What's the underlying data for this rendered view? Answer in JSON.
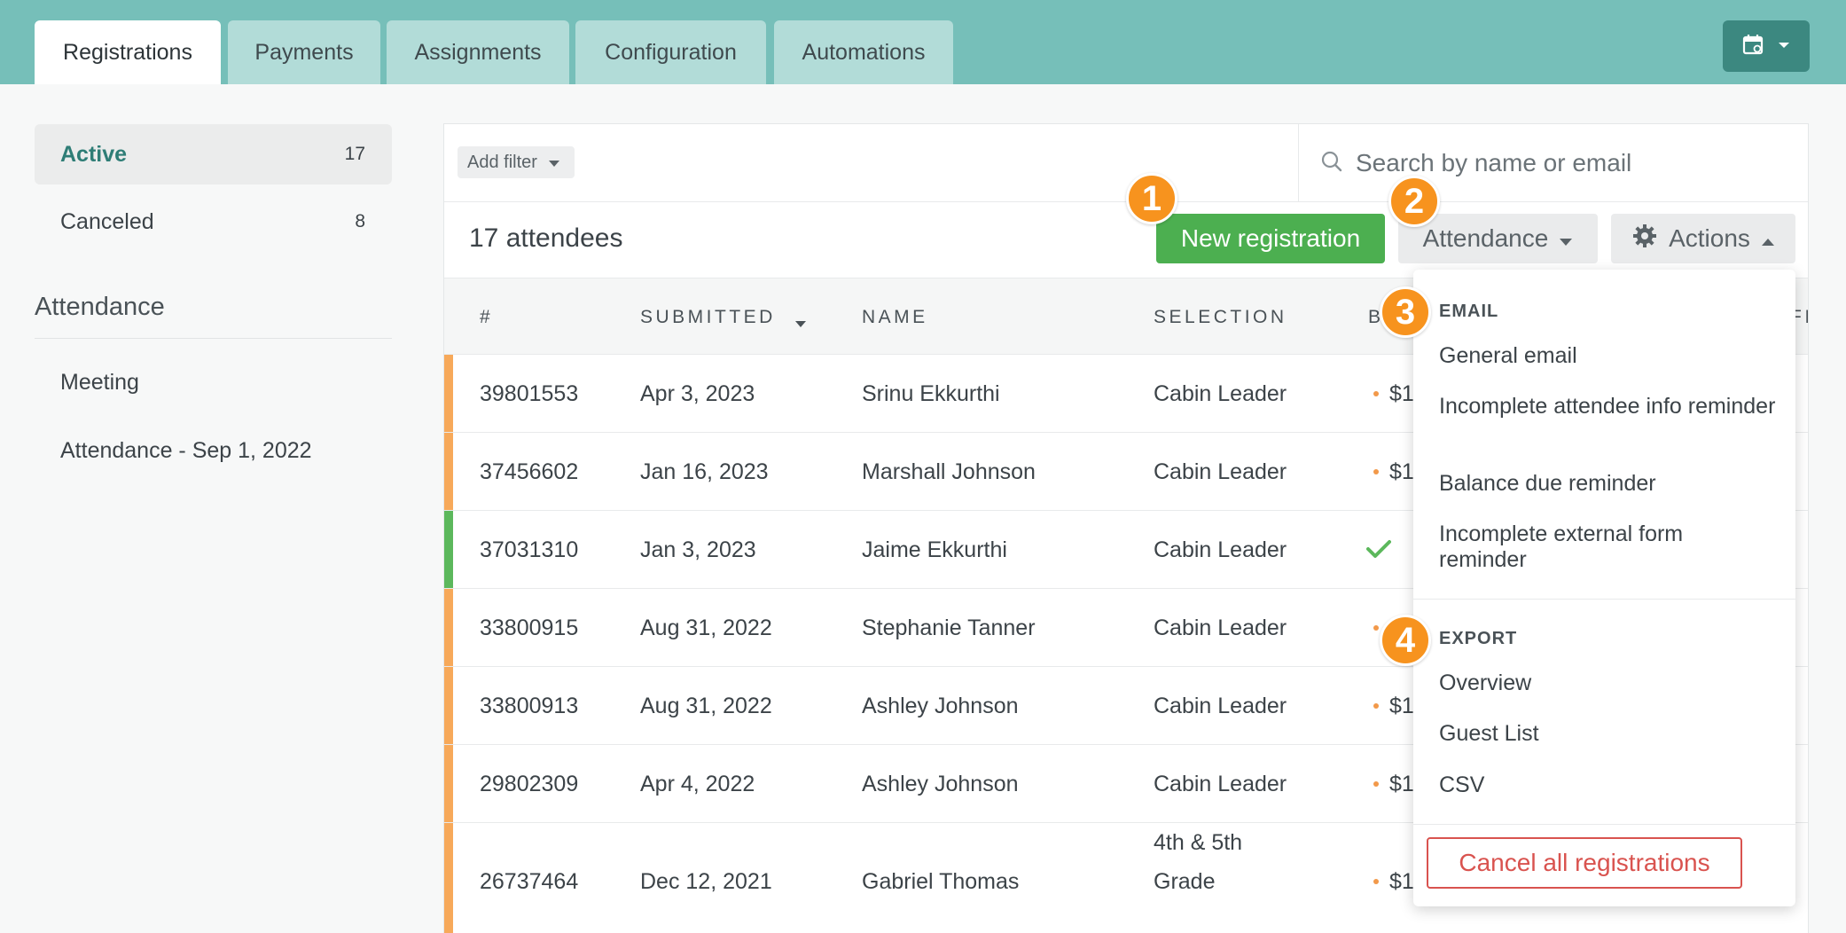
{
  "tabs": [
    {
      "label": "Registrations",
      "active": true
    },
    {
      "label": "Payments",
      "active": false
    },
    {
      "label": "Assignments",
      "active": false
    },
    {
      "label": "Configuration",
      "active": false
    },
    {
      "label": "Automations",
      "active": false
    }
  ],
  "sidebar": {
    "statuses": [
      {
        "label": "Active",
        "count": "17",
        "active": true
      },
      {
        "label": "Canceled",
        "count": "8",
        "active": false
      }
    ],
    "attendance_heading": "Attendance",
    "attendance_items": [
      {
        "label": "Meeting"
      },
      {
        "label": "Attendance - Sep 1, 2022"
      }
    ]
  },
  "filter": {
    "add_filter_label": "Add filter",
    "search_placeholder": "Search by name or email"
  },
  "toolbar": {
    "attendee_count": "17 attendees",
    "new_registration_label": "New registration",
    "attendance_label": "Attendance",
    "actions_label": "Actions"
  },
  "table": {
    "columns": [
      "#",
      "SUBMITTED",
      "NAME",
      "SELECTION",
      "B",
      "FI"
    ],
    "rows": [
      {
        "id": "39801553",
        "submitted": "Apr 3, 2023",
        "name": "Srinu Ekkurthi",
        "selection": "Cabin Leader",
        "balance": "$1",
        "status": "pending"
      },
      {
        "id": "37456602",
        "submitted": "Jan 16, 2023",
        "name": "Marshall Johnson",
        "selection": "Cabin Leader",
        "balance": "$1",
        "status": "pending"
      },
      {
        "id": "37031310",
        "submitted": "Jan 3, 2023",
        "name": "Jaime Ekkurthi",
        "selection": "Cabin Leader",
        "balance": "",
        "status": "paid"
      },
      {
        "id": "33800915",
        "submitted": "Aug 31, 2022",
        "name": "Stephanie Tanner",
        "selection": "Cabin Leader",
        "balance": "",
        "status": "pending"
      },
      {
        "id": "33800913",
        "submitted": "Aug 31, 2022",
        "name": "Ashley Johnson",
        "selection": "Cabin Leader",
        "balance": "$1",
        "status": "pending"
      },
      {
        "id": "29802309",
        "submitted": "Apr 4, 2022",
        "name": "Ashley Johnson",
        "selection": "Cabin Leader",
        "balance": "$1",
        "status": "pending"
      },
      {
        "id": "26737464",
        "submitted": "Dec 12, 2021",
        "name": "Gabriel Thomas",
        "selection_line1": "4th & 5th",
        "selection_line2": "Grade",
        "balance": "$1",
        "status": "pending"
      }
    ]
  },
  "actions_menu": {
    "email_heading": "EMAIL",
    "email_items": [
      "General email",
      "Incomplete attendee info reminder",
      "Balance due reminder",
      "Incomplete external form reminder"
    ],
    "export_heading": "EXPORT",
    "export_items": [
      "Overview",
      "Guest List",
      "CSV"
    ],
    "cancel_all_label": "Cancel all registrations"
  },
  "callouts": [
    "1",
    "2",
    "3",
    "4"
  ],
  "colors": {
    "topbar": "#76bfb9",
    "accent_green": "#4caf50",
    "pending_stripe": "#f7a95a",
    "paid_stripe": "#5cb85c",
    "danger": "#d9534f",
    "callout": "#f7931e"
  }
}
